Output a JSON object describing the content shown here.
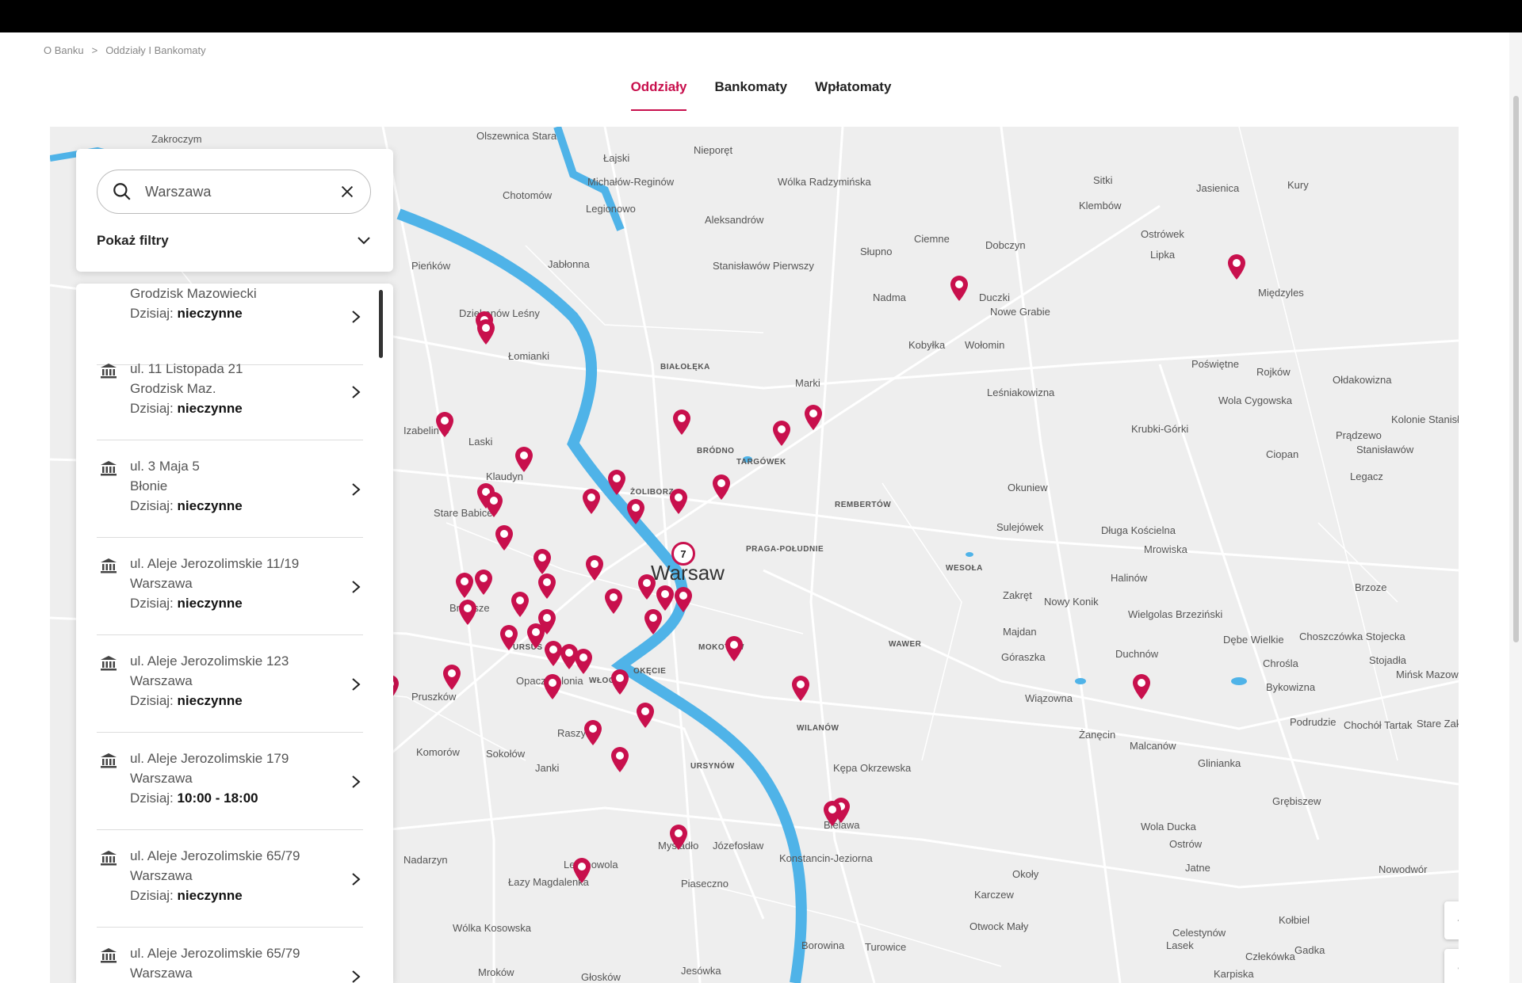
{
  "breadcrumb": {
    "root": "O Banku",
    "sep": ">",
    "current": "Oddziały I Bankomaty"
  },
  "tabs": [
    {
      "label": "Oddziały",
      "active": true
    },
    {
      "label": "Bankomaty",
      "active": false
    },
    {
      "label": "Wpłatomaty",
      "active": false
    }
  ],
  "search": {
    "value": "Warszawa",
    "filters_label": "Pokaż filtry"
  },
  "today_label": "Dzisiaj:",
  "branches": [
    {
      "street": "",
      "city": "Grodzisk Mazowiecki",
      "hours": "nieczynne"
    },
    {
      "street": "ul. 11 Listopada 21",
      "city": "Grodzisk Maz.",
      "hours": "nieczynne"
    },
    {
      "street": "ul. 3 Maja 5",
      "city": "Błonie",
      "hours": "nieczynne"
    },
    {
      "street": "ul. Aleje Jerozolimskie 11/19",
      "city": "Warszawa",
      "hours": "nieczynne"
    },
    {
      "street": "ul. Aleje Jerozolimskie 123",
      "city": "Warszawa",
      "hours": "nieczynne"
    },
    {
      "street": "ul. Aleje Jerozolimskie 179",
      "city": "Warszawa",
      "hours": "10:00 - 18:00"
    },
    {
      "street": "ul. Aleje Jerozolimskie 65/79",
      "city": "Warszawa",
      "hours": "nieczynne"
    },
    {
      "street": "ul. Aleje Jerozolimskie 65/79",
      "city": "Warszawa",
      "hours": ""
    }
  ],
  "map": {
    "city_label": "Warsaw",
    "cluster_count": "7",
    "zoom_in": "+",
    "zoom_out": "−",
    "pin_color": "#c8104d",
    "river_color": "#4fb3e8",
    "places": [
      "Zakroczym",
      "Olszewnica Stara",
      "Łajski",
      "Nieporęt",
      "Michałów-Reginów",
      "Chotomów",
      "Wólka Radzymińska",
      "Legionowo",
      "Aleksandrów",
      "Jabłonna",
      "Stanisławów Pierwszy",
      "Słupno",
      "Ciemne",
      "Sitki",
      "Jasienica",
      "Kury",
      "Klembów",
      "Ostrówek",
      "Dobczyn",
      "Lipka",
      "Pieńków",
      "Dziekanów Leśny",
      "Łomianki",
      "Nadma",
      "Duczki",
      "Nowe Grabie",
      "Międzyles",
      "Marki",
      "Kobyłka",
      "Wołomin",
      "Poświętne",
      "Rojków",
      "Ołdakowizna",
      "Leśniakowizna",
      "Wola Cygowska",
      "Kolonie Stanisławów",
      "Izabelin C",
      "Laski",
      "Krubki-Górki",
      "Prądzewo",
      "Stanisławów",
      "Ciopan",
      "Klaudyn",
      "Legacz",
      "Stare Babice",
      "Okuniew",
      "Sulejówek",
      "Długa Kościelna",
      "Mrowiska",
      "Halinów",
      "Zakręt",
      "Nowy Konik",
      "Brzoze",
      "Bronisze",
      "Majdan",
      "Wielgolas Brzeziński",
      "Dębe Wielkie",
      "Choszczówka Stojecka",
      "Stojadła",
      "Góraszka",
      "Duchnów",
      "Chrośla",
      "Bykowizna",
      "Mińsk Mazowiecki",
      "Pruszków",
      "Opacz Kolonia",
      "Raszyn",
      "Wiązowna",
      "Żanęcin",
      "Podrudzie",
      "Chochół Tartak",
      "Stare Zakole",
      "Komorów",
      "Sokołów",
      "Janki",
      "Malcanów",
      "Glinianka",
      "Kępa Okrzewska",
      "Grębiszew",
      "Bielawa",
      "Wola Ducka",
      "Ostrów",
      "Mysiadło",
      "Józefosław",
      "Konstancin-Jeziorna",
      "Nadarzyn",
      "Lesznowola",
      "Łazy Magdalenka",
      "Piaseczno",
      "Okoły",
      "Jatne",
      "Nowodwór",
      "Karczew",
      "Otwock Mały",
      "Kołbiel",
      "Wólka Kosowska",
      "Celestynów",
      "Lasek",
      "Człekówka",
      "Gadka",
      "Borowina",
      "Turowice",
      "Mroków",
      "Jesówka",
      "Głosków",
      "Karpiska"
    ],
    "districts": [
      "BIAŁOŁĘKA",
      "TARGÓWEK",
      "ŻOLIBORZ",
      "REMBERTÓW",
      "WESOŁA",
      "WAWER",
      "URSUS",
      "OKĘCIE",
      "WŁOCHY",
      "MOKOTÓW",
      "WILANÓW",
      "URSYNÓW",
      "BRÓDNO",
      "PRAGA-POŁUDNIE"
    ]
  }
}
